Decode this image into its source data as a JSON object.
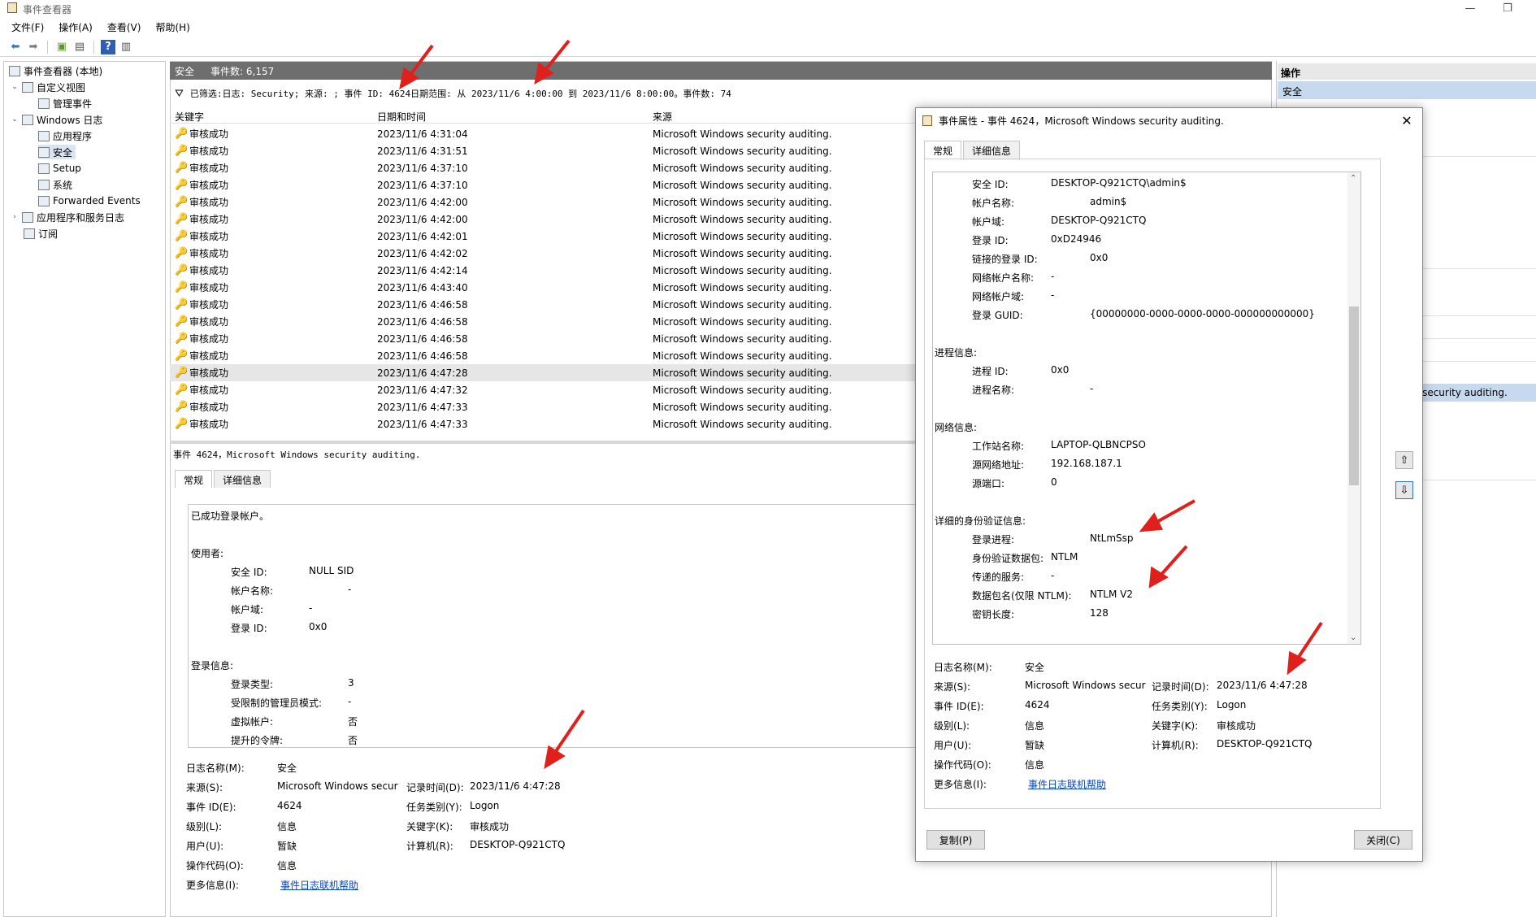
{
  "window": {
    "title": "事件查看器"
  },
  "menu": [
    "文件(F)",
    "操作(A)",
    "查看(V)",
    "帮助(H)"
  ],
  "tree": {
    "root": "事件查看器 (本地)",
    "custom_views": "自定义视图",
    "admin_events": "管理事件",
    "windows_logs": "Windows 日志",
    "application": "应用程序",
    "security": "安全",
    "setup": "Setup",
    "system": "系统",
    "forwarded": "Forwarded Events",
    "app_service_logs": "应用程序和服务日志",
    "subscriptions": "订阅"
  },
  "list_header": {
    "name": "安全",
    "count": "事件数: 6,157"
  },
  "filter": "已筛选:日志: Security; 来源: ; 事件 ID: 4624日期范围: 从 2023/11/6 4:00:00 到 2023/11/6 8:00:00。事件数: 74",
  "columns": {
    "keyword": "关键字",
    "datetime": "日期和时间",
    "source": "来源"
  },
  "events": [
    {
      "keyword": "审核成功",
      "datetime": "2023/11/6 4:31:04",
      "source": "Microsoft Windows security auditing."
    },
    {
      "keyword": "审核成功",
      "datetime": "2023/11/6 4:31:51",
      "source": "Microsoft Windows security auditing."
    },
    {
      "keyword": "审核成功",
      "datetime": "2023/11/6 4:37:10",
      "source": "Microsoft Windows security auditing."
    },
    {
      "keyword": "审核成功",
      "datetime": "2023/11/6 4:37:10",
      "source": "Microsoft Windows security auditing."
    },
    {
      "keyword": "审核成功",
      "datetime": "2023/11/6 4:42:00",
      "source": "Microsoft Windows security auditing."
    },
    {
      "keyword": "审核成功",
      "datetime": "2023/11/6 4:42:00",
      "source": "Microsoft Windows security auditing."
    },
    {
      "keyword": "审核成功",
      "datetime": "2023/11/6 4:42:01",
      "source": "Microsoft Windows security auditing."
    },
    {
      "keyword": "审核成功",
      "datetime": "2023/11/6 4:42:02",
      "source": "Microsoft Windows security auditing."
    },
    {
      "keyword": "审核成功",
      "datetime": "2023/11/6 4:42:14",
      "source": "Microsoft Windows security auditing."
    },
    {
      "keyword": "审核成功",
      "datetime": "2023/11/6 4:43:40",
      "source": "Microsoft Windows security auditing."
    },
    {
      "keyword": "审核成功",
      "datetime": "2023/11/6 4:46:58",
      "source": "Microsoft Windows security auditing."
    },
    {
      "keyword": "审核成功",
      "datetime": "2023/11/6 4:46:58",
      "source": "Microsoft Windows security auditing."
    },
    {
      "keyword": "审核成功",
      "datetime": "2023/11/6 4:46:58",
      "source": "Microsoft Windows security auditing."
    },
    {
      "keyword": "审核成功",
      "datetime": "2023/11/6 4:46:58",
      "source": "Microsoft Windows security auditing."
    },
    {
      "keyword": "审核成功",
      "datetime": "2023/11/6 4:47:28",
      "source": "Microsoft Windows security auditing."
    },
    {
      "keyword": "审核成功",
      "datetime": "2023/11/6 4:47:32",
      "source": "Microsoft Windows security auditing."
    },
    {
      "keyword": "审核成功",
      "datetime": "2023/11/6 4:47:33",
      "source": "Microsoft Windows security auditing."
    },
    {
      "keyword": "审核成功",
      "datetime": "2023/11/6 4:47:33",
      "source": "Microsoft Windows security auditing."
    }
  ],
  "detail": {
    "title": "事件 4624，Microsoft Windows security auditing.",
    "tabs": [
      "常规",
      "详细信息"
    ],
    "lines": {
      "l1": "已成功登录帐户。",
      "subject": "使用者:",
      "sid_label": "安全 ID:",
      "sid": "NULL SID",
      "acct_label": "帐户名称:",
      "acct": "-",
      "domain_label": "帐户域:",
      "domain": "-",
      "logonid_label": "登录 ID:",
      "logonid": "0x0",
      "logoninfo": "登录信息:",
      "type_label": "登录类型:",
      "type": "3",
      "restricted_label": "受限制的管理员模式:",
      "restricted": "-",
      "virtual_label": "虚拟帐户:",
      "virtual": "否",
      "elevated_label": "提升的令牌:",
      "elevated": "否"
    },
    "meta": {
      "logname_l": "日志名称(M):",
      "logname": "安全",
      "source_l": "来源(S):",
      "source": "Microsoft Windows secur",
      "recorded_l": "记录时间(D):",
      "recorded": "2023/11/6 4:47:28",
      "eventid_l": "事件 ID(E):",
      "eventid": "4624",
      "task_l": "任务类别(Y):",
      "task": "Logon",
      "level_l": "级别(L):",
      "level": "信息",
      "keywords_l": "关键字(K):",
      "keywords": "审核成功",
      "user_l": "用户(U):",
      "user": "暂缺",
      "computer_l": "计算机(R):",
      "computer": "DESKTOP-Q921CTQ",
      "opcode_l": "操作代码(O):",
      "opcode": "信息",
      "more_l": "更多信息(I):",
      "more": "事件日志联机帮助"
    }
  },
  "actions": {
    "title": "操作",
    "selected": "安全",
    "row": "s security auditing."
  },
  "dialog": {
    "title": "事件属性 - 事件 4624，Microsoft Windows security auditing.",
    "tabs": [
      "常规",
      "详细信息"
    ],
    "lines": {
      "sid_label": "安全 ID:",
      "sid": "DESKTOP-Q921CTQ\\admin$",
      "acct_label": "帐户名称:",
      "acct": "admin$",
      "domain_label": "帐户域:",
      "domain": "DESKTOP-Q921CTQ",
      "logonid_label": "登录 ID:",
      "logonid": "0xD24946",
      "linked_label": "链接的登录 ID:",
      "linked": "0x0",
      "netacct_label": "网络帐户名称:",
      "netacct": "-",
      "netdomain_label": "网络帐户域:",
      "netdomain": "-",
      "guid_label": "登录 GUID:",
      "guid": "{00000000-0000-0000-0000-000000000000}",
      "process": "进程信息:",
      "pid_label": "进程 ID:",
      "pid": "0x0",
      "pname_label": "进程名称:",
      "pname": "-",
      "network": "网络信息:",
      "ws_label": "工作站名称:",
      "ws": "LAPTOP-QLBNCPSO",
      "srcaddr_label": "源网络地址:",
      "srcaddr": "192.168.187.1",
      "srcport_label": "源端口:",
      "srcport": "0",
      "auth": "详细的身份验证信息:",
      "lproc_label": "登录进程:",
      "lproc": "NtLmSsp",
      "authpkg_label": "身份验证数据包:",
      "authpkg": "NTLM",
      "trans_label": "传递的服务:",
      "trans": "-",
      "pkgname_label": "数据包名(仅限 NTLM):",
      "pkgname": "NTLM V2",
      "keylen_label": "密钥长度:",
      "keylen": "128"
    },
    "copy_button": "复制(P)",
    "close_button": "关闭(C)"
  },
  "colors": {
    "accent": "#0645c7",
    "header_bg": "#6e6e6e",
    "selection": "#c7d9ef",
    "arrow": "#e0201b"
  }
}
